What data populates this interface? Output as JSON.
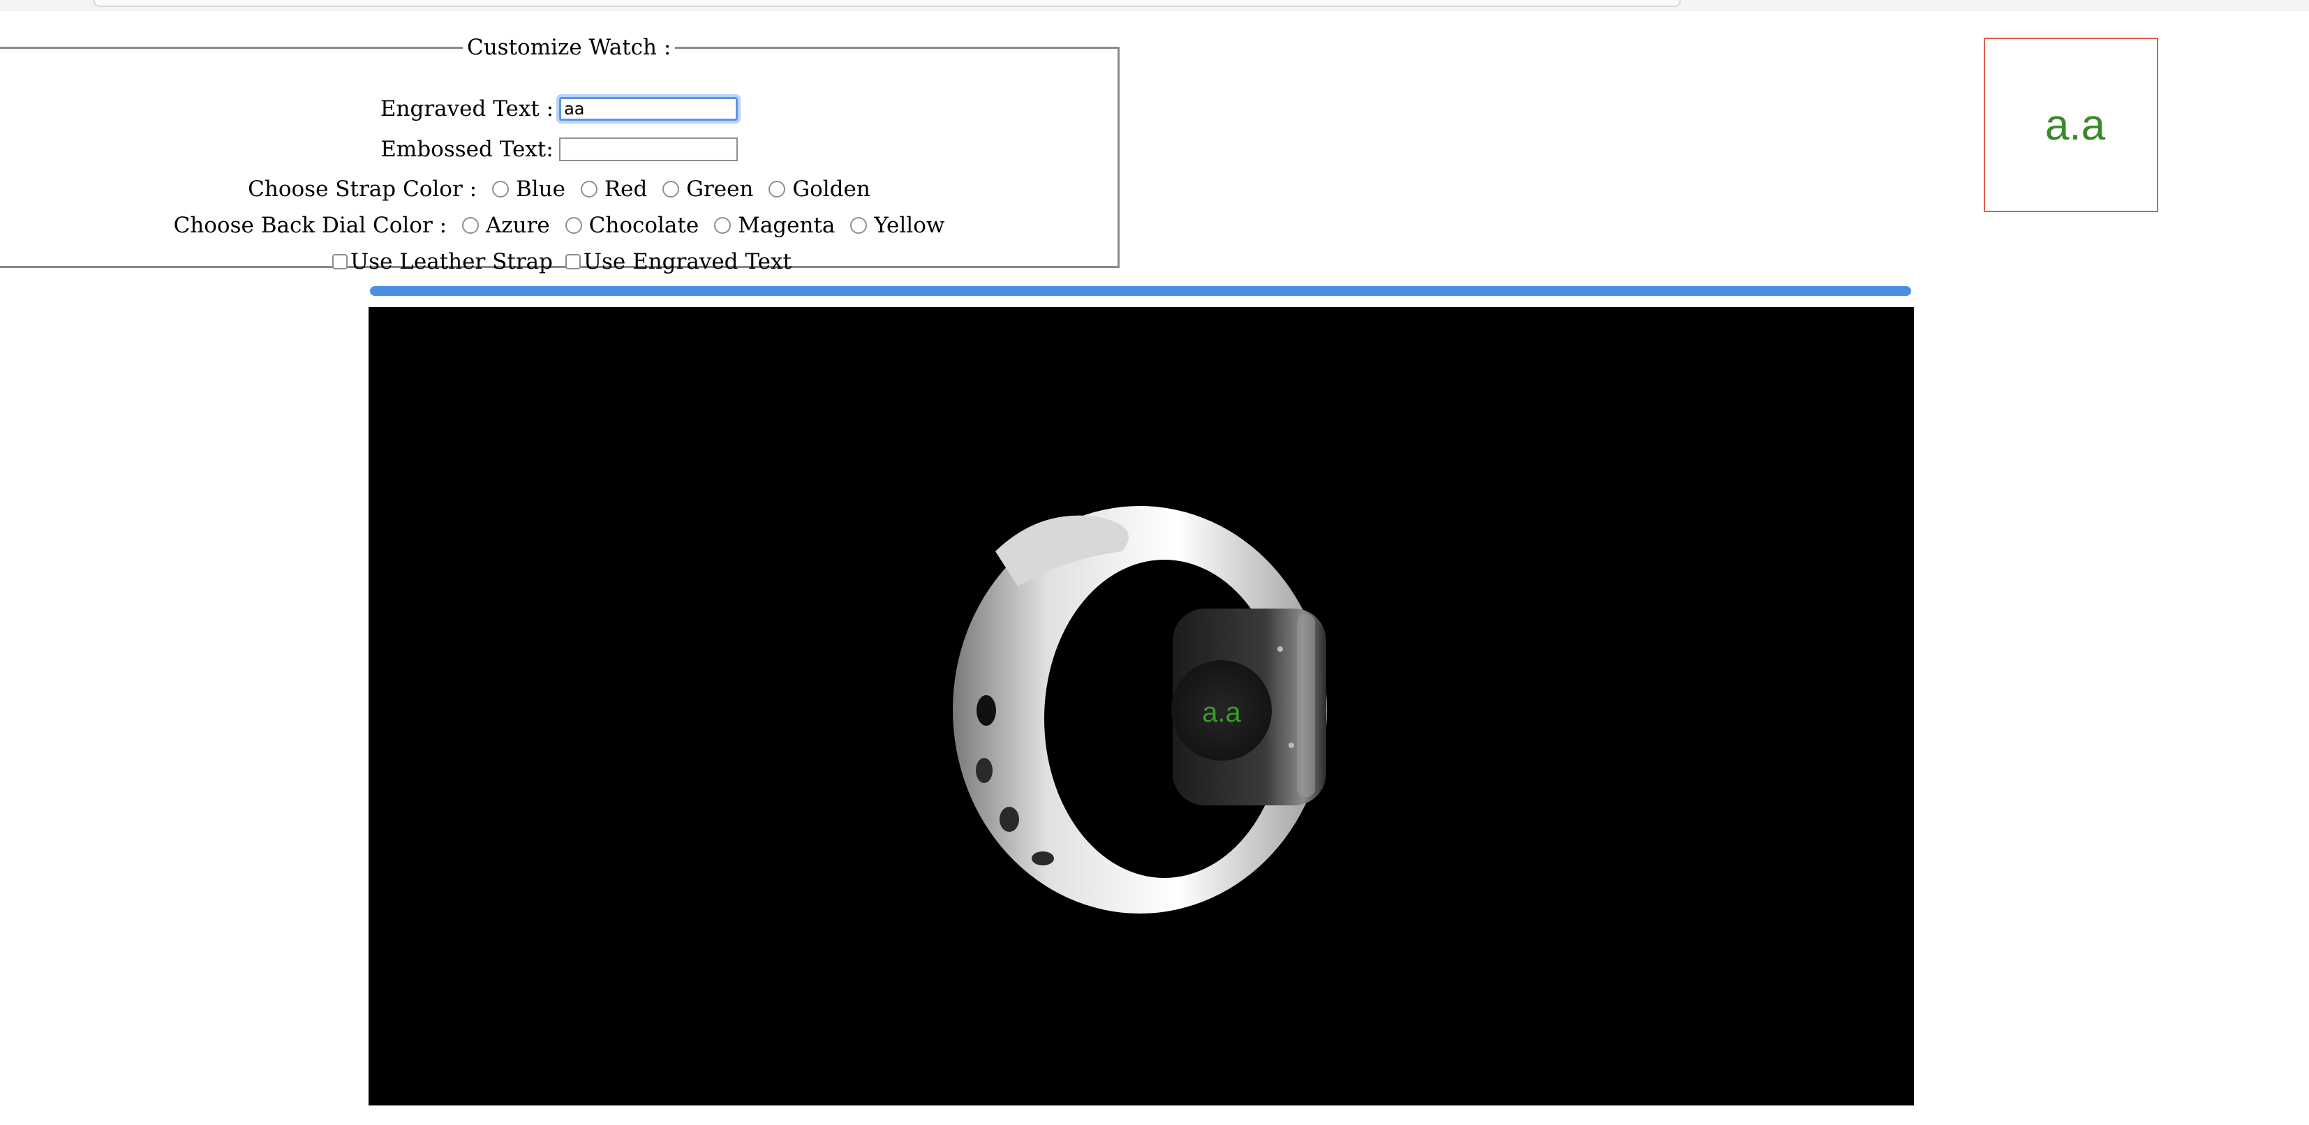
{
  "form": {
    "legend": "Customize Watch :",
    "engraved_label": "Engraved Text :",
    "engraved_value": "aa",
    "embossed_label": "Embossed Text:",
    "embossed_value": "",
    "strap_label": "Choose Strap Color :",
    "strap_options": [
      "Blue",
      "Red",
      "Green",
      "Golden"
    ],
    "dial_label": "Choose Back Dial Color :",
    "dial_options": [
      "Azure",
      "Chocolate",
      "Magenta",
      "Yellow"
    ],
    "leather_label": "Use Leather Strap",
    "engraved_toggle_label": "Use Engraved Text"
  },
  "preview": {
    "text": "a.a",
    "text_color": "#3a8a2a",
    "border_color": "#e25a4a"
  },
  "progress": {
    "fraction": 1.0,
    "color": "#4a90e2"
  },
  "viewer": {
    "background": "#000000",
    "dial_text": "a.a",
    "strap_color": "#e6e6e6",
    "case_color": "#2a2a2a"
  }
}
